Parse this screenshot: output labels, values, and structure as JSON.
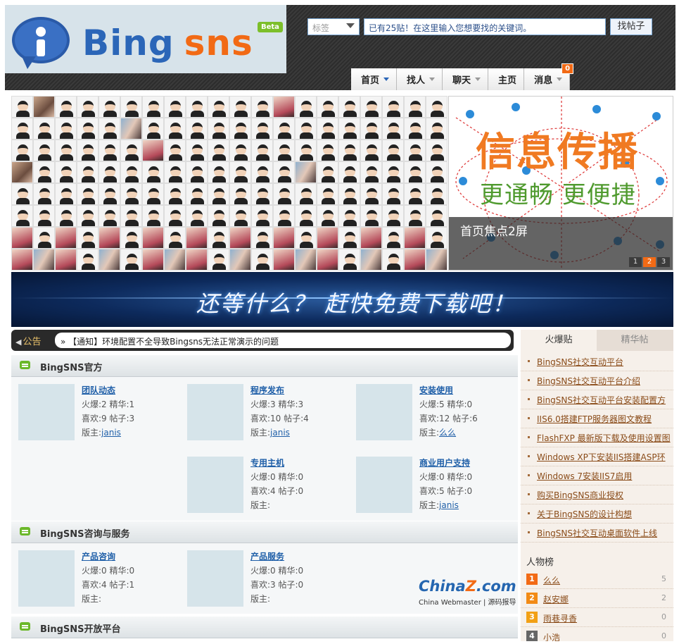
{
  "header": {
    "logo_text_1": "Bing",
    "logo_text_2": "sns",
    "beta": "Beta",
    "tag_select": "标签",
    "search_placeholder": "已有25贴！在这里输入您想要找的关键词。",
    "search_button": "找帖子",
    "nav": [
      {
        "label": "首页",
        "active": true
      },
      {
        "label": "找人",
        "active": false
      },
      {
        "label": "聊天",
        "active": false
      },
      {
        "label": "主页",
        "active": false
      },
      {
        "label": "消息",
        "active": false,
        "badge": "0"
      }
    ]
  },
  "focus": {
    "title": "信息传播",
    "subtitle": "更通畅 更便捷",
    "caption": "首页焦点2屏",
    "pages": [
      "1",
      "2",
      "3"
    ],
    "active_page": "2"
  },
  "download_banner": "还等什么？ 赶快免费下载吧！",
  "notice": {
    "label": "公告",
    "text": "» 【通知】环境配置不全导致Bingsns无法正常演示的问题"
  },
  "sections": [
    {
      "title": "BingSNS官方",
      "boards": [
        {
          "name": "团队动态",
          "hot": "火爆:2 精华:1",
          "likes": "喜欢:9 帖子:3",
          "mod_label": "版主:",
          "mod": "janis"
        },
        {
          "name": "程序发布",
          "hot": "火爆:3 精华:3",
          "likes": "喜欢:10 帖子:4",
          "mod_label": "版主:",
          "mod": "janis"
        },
        {
          "name": "安装使用",
          "hot": "火爆:5 精华:0",
          "likes": "喜欢:12 帖子:6",
          "mod_label": "版主:",
          "mod": "么么"
        },
        {
          "name": "专用主机",
          "hot": "火爆:0 精华:0",
          "likes": "喜欢:4 帖子:0",
          "mod_label": "版主:",
          "mod": ""
        },
        {
          "name": "商业用户支持",
          "hot": "火爆:0 精华:0",
          "likes": "喜欢:5 帖子:0",
          "mod_label": "版主:",
          "mod": "janis"
        }
      ]
    },
    {
      "title": "BingSNS咨询与服务",
      "boards": [
        {
          "name": "产品咨询",
          "hot": "火爆:0 精华:0",
          "likes": "喜欢:4 帖子:1",
          "mod_label": "版主:",
          "mod": ""
        },
        {
          "name": "产品服务",
          "hot": "火爆:0 精华:0",
          "likes": "喜欢:3 帖子:0",
          "mod_label": "版主:",
          "mod": ""
        }
      ]
    },
    {
      "title": "BingSNS开放平台",
      "boards": []
    }
  ],
  "sidebar": {
    "tabs": [
      "火爆贴",
      "精华帖"
    ],
    "hot_posts": [
      "BingSNS社交互动平台",
      "BingSNS社交互动平台介绍",
      "BingSNS社交互动平台安装配置方",
      "IIS6.0搭建FTP服务器图文教程",
      "FlashFXP 最新版下载及使用设置图",
      "Windows XP下安装IIS搭建ASP环",
      "Windows 7安装IIS7启用",
      "购买BingSNS商业授权",
      "关于BingSNS的设计构想",
      "BingSNS社交互动桌面软件上线"
    ],
    "people_title": "人物榜",
    "people": [
      {
        "rank": "1",
        "name": "么么",
        "count": "5",
        "color": "#f26a15"
      },
      {
        "rank": "2",
        "name": "赵安娜",
        "count": "2",
        "color": "#f28a15"
      },
      {
        "rank": "3",
        "name": "雨巷寻香",
        "count": "0",
        "color": "#f2a015"
      },
      {
        "rank": "4",
        "name": "小浩",
        "count": "0",
        "color": "#666666"
      }
    ]
  },
  "watermark": {
    "brand_1": "China",
    "brand_z": "Z",
    "brand_2": ".com",
    "sub": "China Webmaster | 源码报导"
  }
}
